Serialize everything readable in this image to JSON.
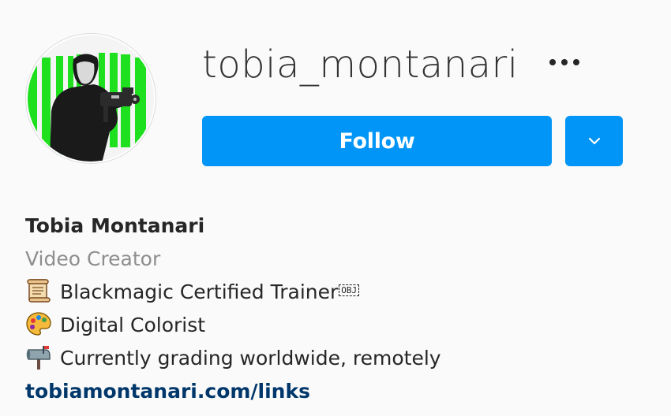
{
  "profile": {
    "username": "tobia_montanari",
    "full_name": "Tobia Montanari",
    "category": "Video Creator",
    "bio_lines": [
      {
        "icon": "scroll-icon",
        "text": "Blackmagic Certified Trainer",
        "suffix": "OBJ"
      },
      {
        "icon": "palette-icon",
        "text": "Digital Colorist"
      },
      {
        "icon": "mailbox-icon",
        "text": "Currently grading worldwide, remotely"
      }
    ],
    "link": "tobiamontanari.com/links"
  },
  "actions": {
    "follow_label": "Follow",
    "more_icon": "more-options-icon",
    "dropdown_icon": "chevron-down-icon"
  },
  "colors": {
    "follow_blue": "#0095f6",
    "link_blue": "#00376b",
    "muted_gray": "#8e8e8e",
    "green_bg": "#1fe01f"
  }
}
